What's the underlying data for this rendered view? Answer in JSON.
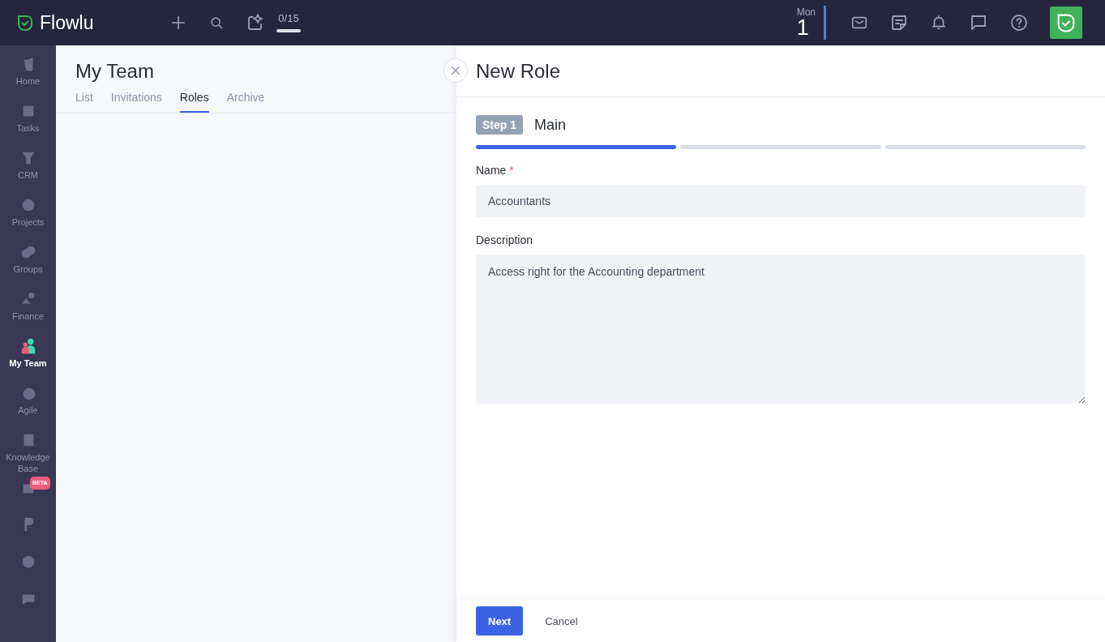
{
  "topbar": {
    "logo": "Flowlu",
    "counter": "0/15",
    "date": {
      "weekday": "Mon",
      "day": "1"
    }
  },
  "sidebar": {
    "items": [
      {
        "kind": "labeled",
        "label": "Home",
        "selected": false
      },
      {
        "kind": "labeled",
        "label": "Tasks",
        "selected": false
      },
      {
        "kind": "labeled",
        "label": "CRM",
        "selected": false
      },
      {
        "kind": "labeled",
        "label": "Projects",
        "selected": false
      },
      {
        "kind": "labeled",
        "label": "Groups",
        "selected": false
      },
      {
        "kind": "labeled",
        "label": "Finance",
        "selected": false
      },
      {
        "kind": "labeled",
        "label": "My Team",
        "selected": true
      },
      {
        "kind": "labeled",
        "label": "Agile",
        "selected": false
      },
      {
        "kind": "labeled",
        "label": "Knowledge Base",
        "selected": false
      },
      {
        "kind": "icon",
        "badge": "BETA",
        "selected": false
      },
      {
        "kind": "icon",
        "selected": false
      },
      {
        "kind": "icon",
        "selected": false
      },
      {
        "kind": "icon",
        "selected": false
      }
    ]
  },
  "page": {
    "title": "My Team",
    "tabs": [
      {
        "label": "List",
        "selected": false
      },
      {
        "label": "Invitations",
        "selected": false
      },
      {
        "label": "Roles",
        "selected": true
      },
      {
        "label": "Archive",
        "selected": false
      }
    ]
  },
  "panel": {
    "title": "New Role",
    "step": {
      "badge": "Step 1",
      "title": "Main"
    },
    "progress": [
      {
        "level": 1
      },
      {
        "level": 0
      },
      {
        "level": 0
      }
    ],
    "fields": [
      {
        "kind": "input",
        "label": "Name",
        "required_mark": "*",
        "value": "Accountants"
      },
      {
        "kind": "textarea",
        "label": "Description",
        "value": "Access right for the Accounting department"
      }
    ],
    "buttons": [
      {
        "kind": "primary",
        "label": "Next"
      },
      {
        "kind": "plain",
        "label": "Cancel"
      }
    ]
  }
}
